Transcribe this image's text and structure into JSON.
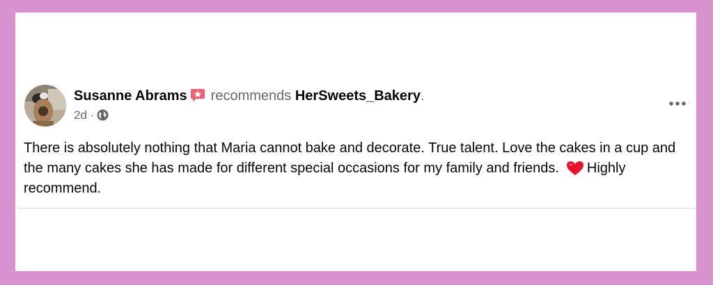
{
  "post": {
    "author_name": "Susanne Abrams",
    "recommends_word": "recommends",
    "page_name": "HerSweets_Bakery",
    "punctuation": ".",
    "timestamp": "2d",
    "separator": "·",
    "audience_icon": "globe-icon",
    "badge_icon": "star-badge-icon",
    "more_icon": "more-options-icon",
    "text_part1": "There is absolutely nothing that Maria cannot bake and decorate.  True talent. Love the cakes in a cup and the many cakes she has made for different special occasions for my family and friends.",
    "heart_icon": "red-heart-icon",
    "text_part2": "Highly recommend."
  },
  "colors": {
    "frame": "#d892d0",
    "badge": "#f05f70",
    "heart": "#e8132c",
    "secondary_text": "#65676b"
  }
}
